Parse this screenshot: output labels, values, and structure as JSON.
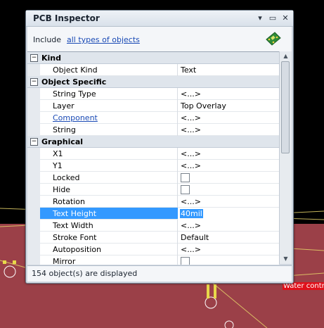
{
  "panel": {
    "title": "PCB Inspector",
    "menu_glyph": "▾",
    "pin_glyph": "▭",
    "close_glyph": "✕",
    "include_label": "Include",
    "include_link": "all types of objects",
    "status": "154 object(s) are displayed"
  },
  "categories": {
    "kind": "Kind",
    "object_specific": "Object Specific",
    "graphical": "Graphical"
  },
  "rows": {
    "object_kind": {
      "name": "Object Kind",
      "value": "Text"
    },
    "string_type": {
      "name": "String Type",
      "value": "<...>"
    },
    "layer": {
      "name": "Layer",
      "value": "Top Overlay"
    },
    "component": {
      "name": "Component",
      "value": "<...>"
    },
    "string": {
      "name": "String",
      "value": "<...>"
    },
    "x1": {
      "name": "X1",
      "value": "<...>"
    },
    "y1": {
      "name": "Y1",
      "value": "<...>"
    },
    "locked": {
      "name": "Locked",
      "checked": false
    },
    "hide": {
      "name": "Hide",
      "checked": false
    },
    "rotation": {
      "name": "Rotation",
      "value": "<...>"
    },
    "text_height": {
      "name": "Text Height",
      "value": "40mil"
    },
    "text_width": {
      "name": "Text Width",
      "value": "<...>"
    },
    "stroke_font": {
      "name": "Stroke Font",
      "value": "Default"
    },
    "autoposition": {
      "name": "Autoposition",
      "value": "<...>"
    },
    "mirror": {
      "name": "Mirror",
      "checked": false
    }
  },
  "canvas": {
    "label": "Water contr",
    "board_color": "#9b4048",
    "background_color": "#000000"
  },
  "icons": {
    "collapse": "minus-box-icon",
    "pcb": "pcb-board-icon"
  }
}
